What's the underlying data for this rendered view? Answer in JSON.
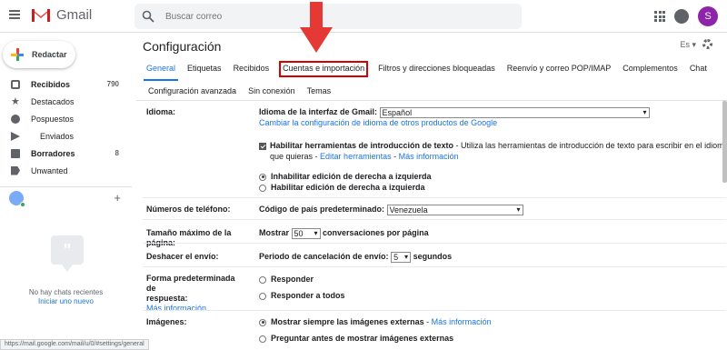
{
  "app": {
    "name": "Gmail",
    "avatar_letter": "S",
    "accent": "#1a73e8",
    "avatar_color": "#8e24aa"
  },
  "search": {
    "placeholder": "Buscar correo"
  },
  "sidebar": {
    "compose_label": "Redactar",
    "items": [
      {
        "label": "Recibidos",
        "count": "790",
        "icon": "inbox-icon",
        "bold": true
      },
      {
        "label": "Destacados",
        "count": "",
        "icon": "star-icon",
        "bold": false
      },
      {
        "label": "Pospuestos",
        "count": "",
        "icon": "clock-icon",
        "bold": false
      },
      {
        "label": "Enviados",
        "count": "",
        "icon": "send-icon",
        "bold": false
      },
      {
        "label": "Borradores",
        "count": "8",
        "icon": "draft-icon",
        "bold": true
      },
      {
        "label": "Unwanted",
        "count": "",
        "icon": "label-icon",
        "bold": false
      }
    ],
    "no_chats": "No hay chats recientes",
    "start_new": "Iniciar uno nuevo"
  },
  "settings": {
    "title": "Configuración",
    "lang_code": "Es",
    "tabs_row1": [
      "General",
      "Etiquetas",
      "Recibidos",
      "Cuentas e importación",
      "Filtros y direcciones bloqueadas",
      "Reenvío y correo POP/IMAP",
      "Complementos",
      "Chat"
    ],
    "tabs_row2": [
      "Configuración avanzada",
      "Sin conexión",
      "Temas"
    ],
    "highlighted_tab_color": "#d50000",
    "rows": {
      "idioma": {
        "label": "Idioma:",
        "interface_label": "Idioma de la interfaz de Gmail:",
        "interface_value": "Español",
        "change_link": "Cambiar la configuración de idioma de otros productos de Google",
        "input_tools_label": "Habilitar herramientas de introducción de texto",
        "input_tools_desc": " - Utiliza las herramientas de introducción de texto para escribir en el idioma",
        "input_tools_desc2": "que quieras - ",
        "edit_tools_link": "Editar herramientas",
        "sep": " - ",
        "more_info_link": "Más información",
        "rtl_off": "Inhabilitar edición de derecha a izquierda",
        "rtl_on": "Habilitar edición de derecha a izquierda"
      },
      "phone": {
        "label": "Números de teléfono:",
        "country_label": "Código de país predeterminado:",
        "country_value": "Venezuela"
      },
      "page_size": {
        "label": "Tamaño máximo de la página:",
        "show": "Mostrar",
        "value": "50",
        "suffix": "conversaciones por página"
      },
      "undo": {
        "label": "Deshacer el envío:",
        "period_label": "Periodo de cancelación de envío:",
        "value": "5",
        "suffix": "segundos"
      },
      "reply": {
        "label_line1": "Forma predeterminada de",
        "label_line2": "respuesta:",
        "more_info": "Más información",
        "opt1": "Responder",
        "opt2": "Responder a todos"
      },
      "images": {
        "label": "Imágenes:",
        "opt1": "Mostrar siempre las imágenes externas",
        "opt1_sep": " - ",
        "opt1_link": "Más información",
        "opt2": "Preguntar antes de mostrar imágenes externas"
      }
    }
  },
  "status_url": "https://mail.google.com/mail/u/0/#settings/general"
}
